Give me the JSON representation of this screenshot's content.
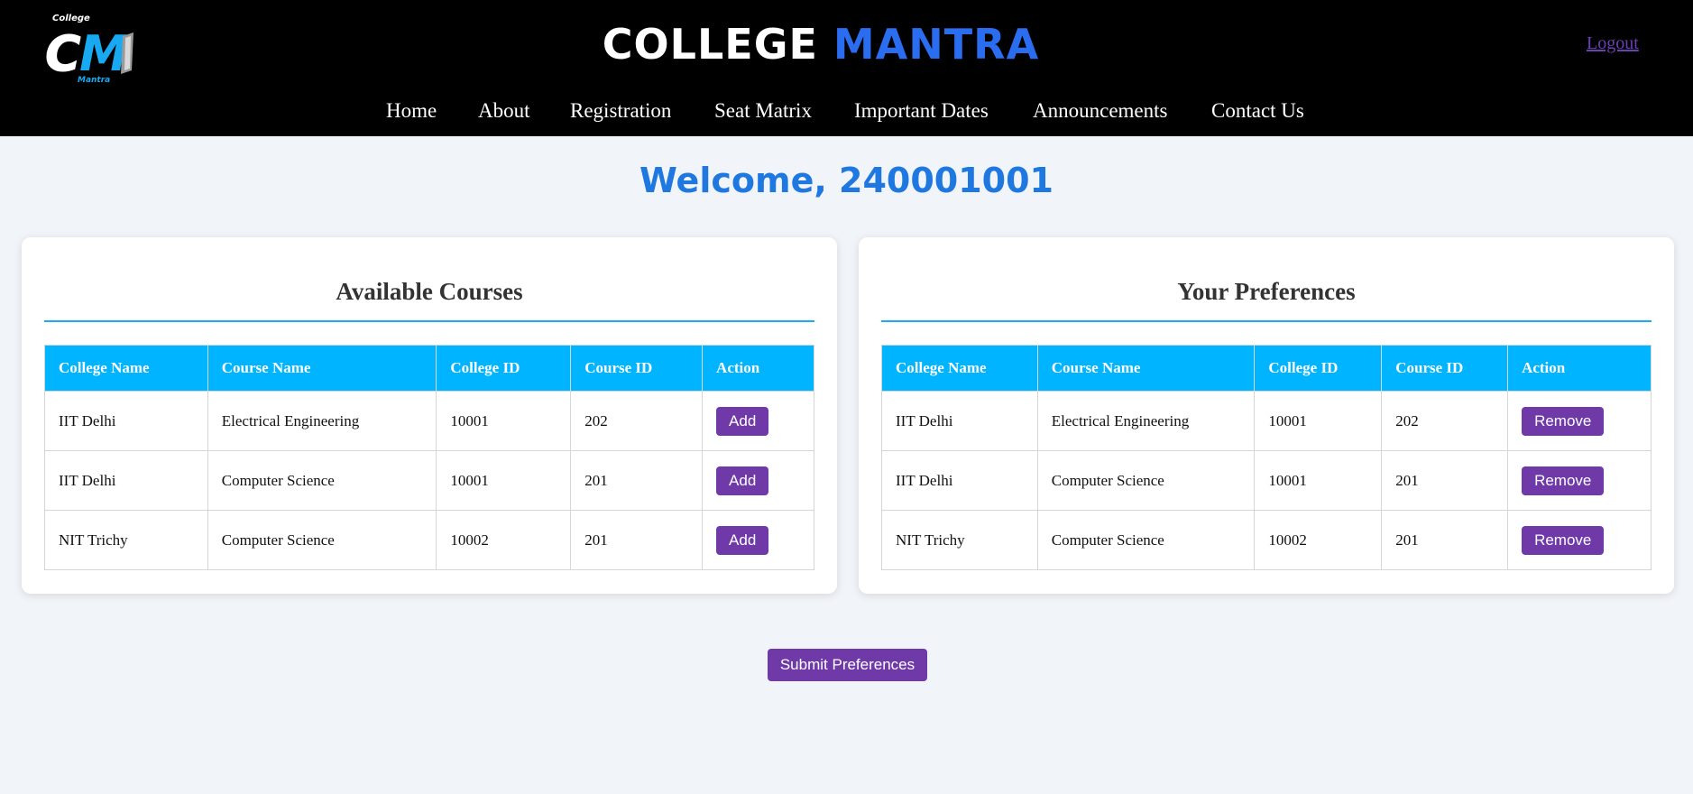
{
  "header": {
    "logo": {
      "top_text": "College",
      "bottom_text": "Mantra",
      "letters": "CM"
    },
    "brand_part1": "COLLEGE",
    "brand_part2": "MANTRA",
    "logout_label": "Logout"
  },
  "nav": [
    "Home",
    "About",
    "Registration",
    "Seat Matrix",
    "Important Dates",
    "Announcements",
    "Contact Us"
  ],
  "welcome": "Welcome, 240001001",
  "available": {
    "title": "Available Courses",
    "columns": [
      "College Name",
      "Course Name",
      "College ID",
      "Course ID",
      "Action"
    ],
    "rows": [
      [
        "IIT Delhi",
        "Electrical Engineering",
        "10001",
        "202",
        "Add"
      ],
      [
        "IIT Delhi",
        "Computer Science",
        "10001",
        "201",
        "Add"
      ],
      [
        "NIT Trichy",
        "Computer Science",
        "10002",
        "201",
        "Add"
      ]
    ]
  },
  "preferences": {
    "title": "Your Preferences",
    "columns": [
      "College Name",
      "Course Name",
      "College ID",
      "Course ID",
      "Action"
    ],
    "rows": [
      [
        "IIT Delhi",
        "Electrical Engineering",
        "10001",
        "202",
        "Remove"
      ],
      [
        "IIT Delhi",
        "Computer Science",
        "10001",
        "201",
        "Remove"
      ],
      [
        "NIT Trichy",
        "Computer Science",
        "10002",
        "201",
        "Remove"
      ]
    ]
  },
  "submit_label": "Submit Preferences",
  "colors": {
    "accent": "#6f3aa8",
    "table_header": "#00b4ff",
    "welcome": "#1f78e0",
    "brand_blue": "#2a6df0"
  }
}
